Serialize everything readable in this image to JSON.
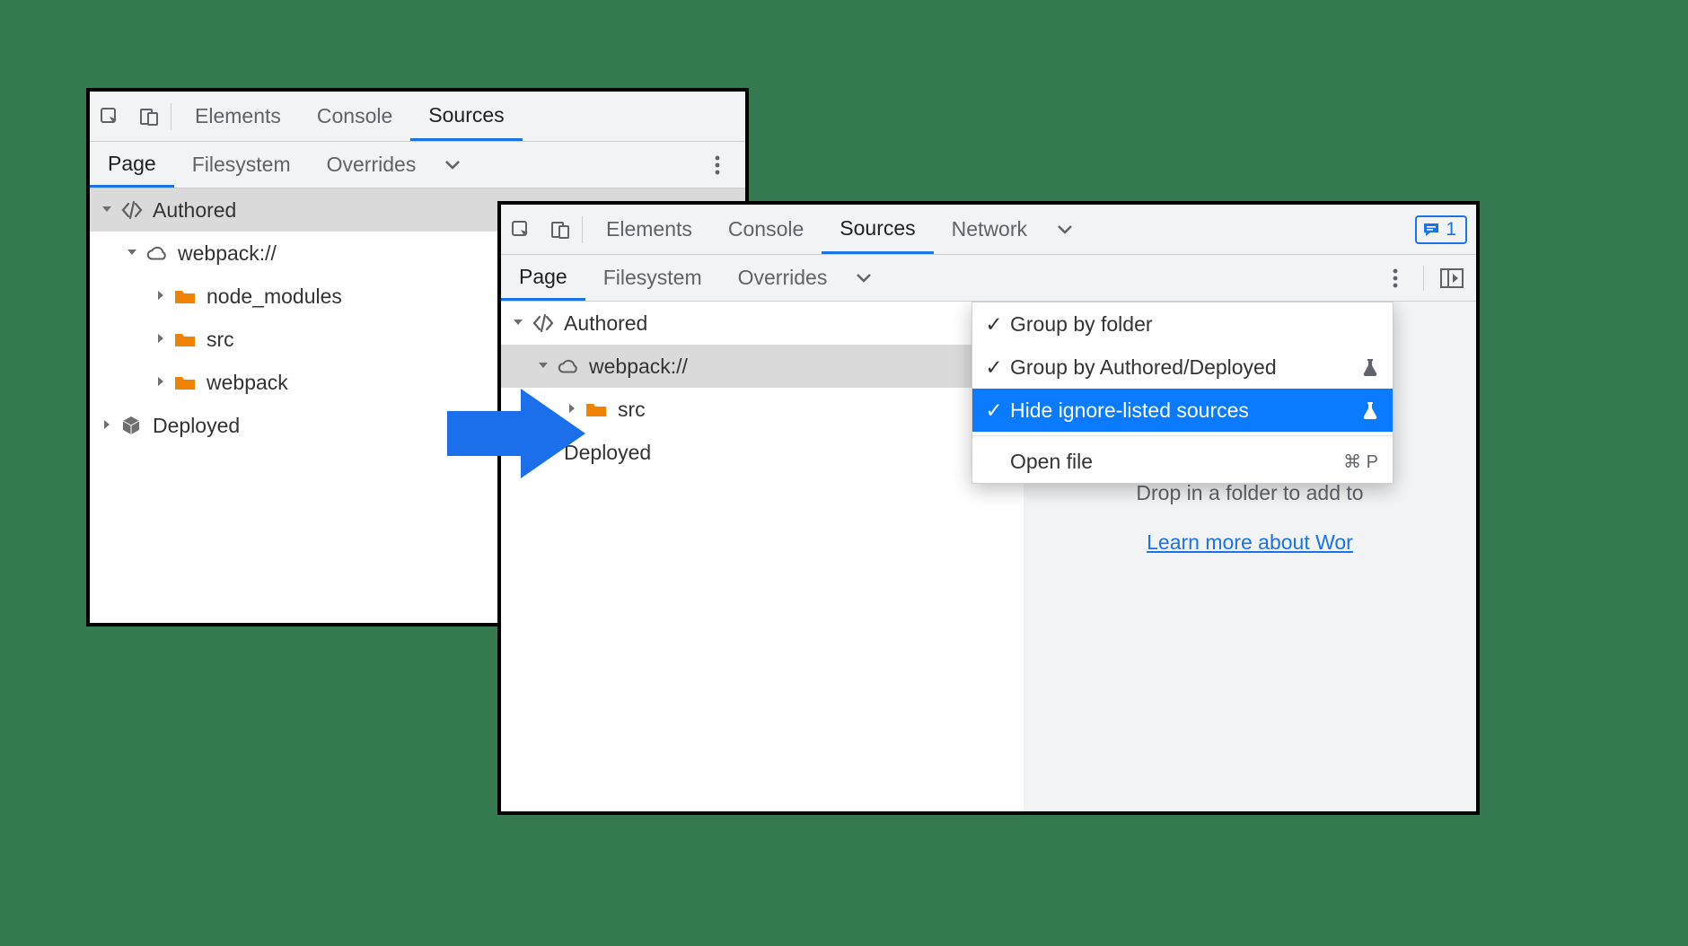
{
  "topbar": {
    "tab_elements": "Elements",
    "tab_console": "Console",
    "tab_sources": "Sources",
    "tab_network": "Network"
  },
  "subbar": {
    "tab_page": "Page",
    "tab_filesystem": "Filesystem",
    "tab_overrides": "Overrides"
  },
  "issue_count": "1",
  "tree_left": {
    "authored": "Authored",
    "webpack": "webpack://",
    "node_modules": "node_modules",
    "src": "src",
    "webpack_folder": "webpack",
    "deployed": "Deployed"
  },
  "tree_right": {
    "authored": "Authored",
    "webpack": "webpack://",
    "src": "src",
    "deployed": "Deployed"
  },
  "menu": {
    "group_folder": "Group by folder",
    "group_authored": "Group by Authored/Deployed",
    "hide_ignore": "Hide ignore-listed sources",
    "open_file": "Open file",
    "open_file_shortcut": "⌘ P"
  },
  "dropzone": {
    "line1": "Drop in a folder to add to",
    "link": "Learn more about Wor"
  }
}
